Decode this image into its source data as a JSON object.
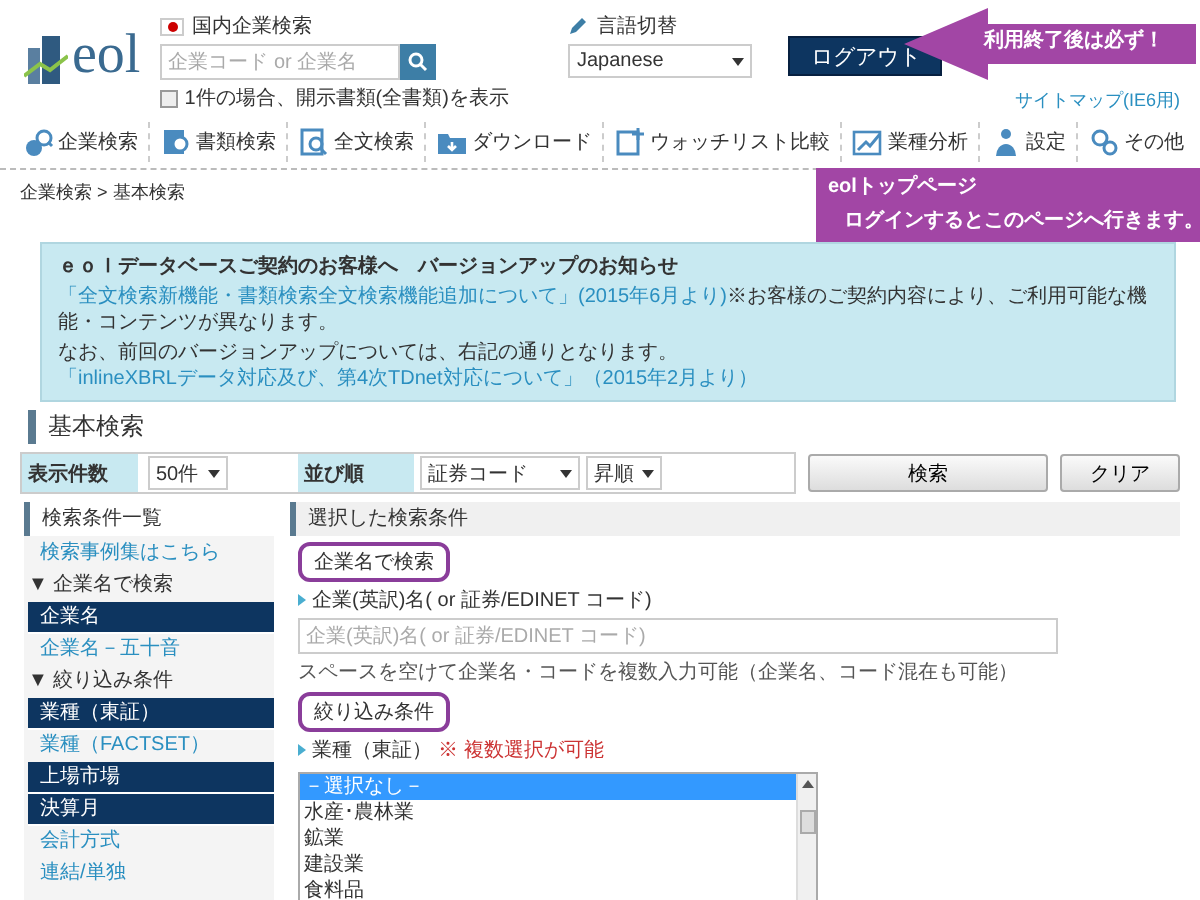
{
  "header": {
    "logo": "eol",
    "search": {
      "scope": "国内企業検索",
      "placeholder": "企業コード or 企業名",
      "option": {
        "label": "1件の場合、開示書類(全書類)を表示",
        "checked": false
      }
    },
    "language": {
      "label": "言語切替",
      "value": "Japanese"
    },
    "logout": "ログアウト",
    "sitemap_link": "サイトマップ(IE6用)"
  },
  "nav": [
    {
      "label": "企業検索"
    },
    {
      "label": "書類検索"
    },
    {
      "label": "全文検索"
    },
    {
      "label": "ダウンロード"
    },
    {
      "label": "ウォッチリスト比較"
    },
    {
      "label": "業種分析"
    },
    {
      "label": "設定"
    },
    {
      "label": "その他"
    }
  ],
  "callouts": [
    {
      "kind": "arrow",
      "lines": [
        "利用終了後は必ず！"
      ]
    },
    {
      "kind": "box",
      "lines": [
        "eolトップページ",
        "ログインするとこのページへ行きます。"
      ]
    }
  ],
  "breadcrumb": "企業検索 > 基本検索",
  "notice": {
    "title": "ｅｏｌデータベースご契約のお客様へ　バージョンアップのお知らせ",
    "lines": [
      [
        {
          "kind": "link",
          "text": "「全文検索新機能・書類検索全文検索機能追加について」(2015年6月より)"
        },
        {
          "kind": "text",
          "text": "※お客様のご契約内容により、ご利用可能な機能・コンテンツが異なります。"
        }
      ],
      [
        {
          "kind": "text",
          "text": "なお、前回のバージョンアップについては、右記の通りとなります。"
        },
        {
          "kind": "link",
          "text": "「inlineXBRLデータ対応及び、第4次TDnet対応について」（2015年2月より）"
        }
      ]
    ]
  },
  "page_title": "基本検索",
  "controls": {
    "count": {
      "label": "表示件数",
      "value": "50件"
    },
    "sort": {
      "label": "並び順",
      "key": "証券コード",
      "order": "昇順"
    },
    "buttons": [
      "検索",
      "クリア"
    ]
  },
  "sidebar": {
    "title": "検索条件一覧",
    "items": [
      {
        "kind": "link",
        "label": "検索事例集はこちら"
      },
      {
        "kind": "group",
        "label": "▼ 企業名で検索"
      },
      {
        "kind": "item",
        "label": "企業名",
        "selected": true
      },
      {
        "kind": "item",
        "label": "企業名－五十音",
        "selected": false
      },
      {
        "kind": "group",
        "label": "▼ 絞り込み条件"
      },
      {
        "kind": "item",
        "label": "業種（東証）",
        "selected": true
      },
      {
        "kind": "item",
        "label": "業種（FACTSET）",
        "selected": false
      },
      {
        "kind": "item",
        "label": "上場市場",
        "selected": true
      },
      {
        "kind": "item",
        "label": "決算月",
        "selected": true
      },
      {
        "kind": "item",
        "label": "会計方式",
        "selected": false
      },
      {
        "kind": "item",
        "label": "連結/単独",
        "selected": false
      }
    ]
  },
  "conditions": {
    "title": "選択した検索条件",
    "sections": [
      {
        "kind": "text",
        "heading": "企業名で検索",
        "label": "企業(英訳)名( or 証券/EDINET コード)",
        "placeholder": "企業(英訳)名( or 証券/EDINET コード)",
        "hint": "スペースを空けて企業名・コードを複数入力可能（企業名、コード混在も可能）"
      },
      {
        "kind": "list",
        "heading": "絞り込み条件",
        "label": "業種（東証）",
        "note": "※ 複数選択が可能",
        "options": [
          {
            "label": "－選択なし－",
            "selected": true
          },
          {
            "label": "水産･農林業",
            "selected": false
          },
          {
            "label": "鉱業",
            "selected": false
          },
          {
            "label": "建設業",
            "selected": false
          },
          {
            "label": "食料品",
            "selected": false
          }
        ]
      }
    ]
  }
}
